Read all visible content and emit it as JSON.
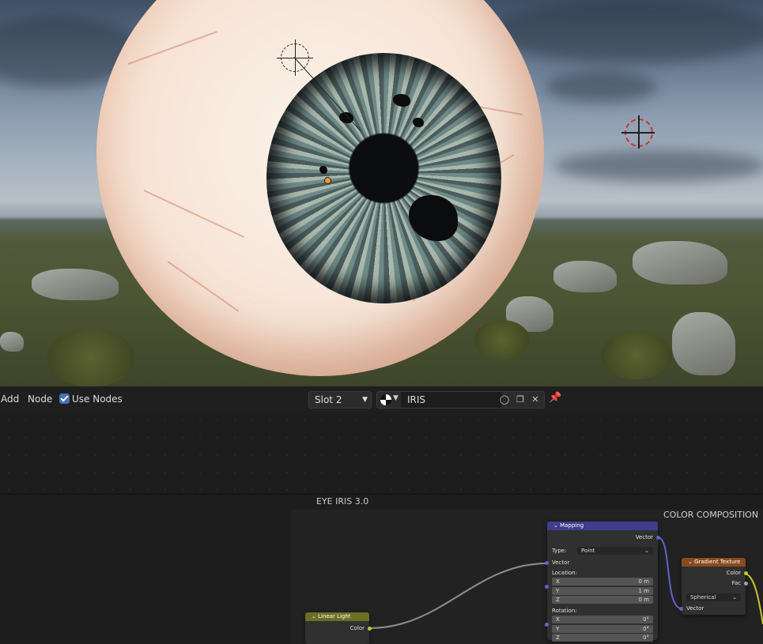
{
  "header": {
    "menu_add": "Add",
    "menu_node": "Node",
    "use_nodes_label": "Use Nodes",
    "slot_value": "Slot 2",
    "material_name": "IRIS"
  },
  "editor": {
    "frame_title": "EYE IRIS 3.0",
    "color_composition_label": "COLOR COMPOSITION"
  },
  "nodes": {
    "mapping": {
      "title": "Mapping",
      "vector_out": "Vector",
      "type_label": "Type:",
      "type_value": "Point",
      "vector_in": "Vector",
      "location_label": "Location:",
      "loc_x_label": "X",
      "loc_x_value": "0 m",
      "loc_y_label": "Y",
      "loc_y_value": "1 m",
      "loc_z_label": "Z",
      "loc_z_value": "0 m",
      "rotation_label": "Rotation:",
      "rot_x_label": "X",
      "rot_x_value": "0°",
      "rot_y_label": "Y",
      "rot_y_value": "0°",
      "rot_z_label": "Z",
      "rot_z_value": "0°"
    },
    "gradient": {
      "title": "Gradient Texture",
      "color_out": "Color",
      "fac_out": "Fac",
      "type_value": "Spherical",
      "vector_in": "Vector"
    },
    "linear_light": {
      "title": "Linear Light",
      "color_out": "Color"
    }
  },
  "colors": {
    "mapping_header": "#3e3d8f",
    "gradient_header": "#8a4a1d",
    "linear_light_header": "#6b6f22",
    "vector_socket": "#6363c7",
    "color_socket": "#c7c729",
    "accent": "#4772b3"
  },
  "icons": [
    "checkbox-checked-icon",
    "material-sphere-icon",
    "chevron-down-icon",
    "fake-user-shield-icon",
    "duplicate-icon",
    "close-icon",
    "pin-icon",
    "light-gizmo-icon",
    "3d-cursor-icon"
  ]
}
